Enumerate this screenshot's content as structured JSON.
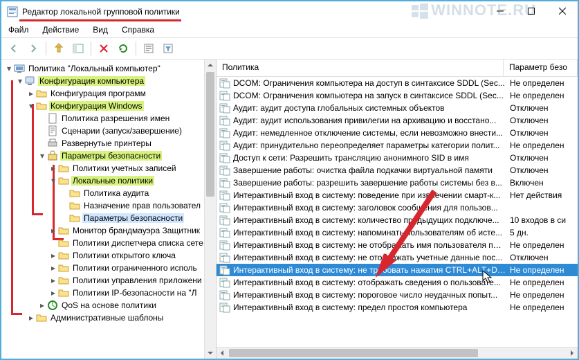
{
  "window": {
    "title": "Редактор локальной групповой политики"
  },
  "watermark": "WINNOTE.RU",
  "menu": {
    "file": "Файл",
    "action": "Действие",
    "view": "Вид",
    "help": "Справка"
  },
  "tree": {
    "root": "Политика \"Локальный компьютер\"",
    "comp_conf": "Конфигурация компьютера",
    "soft_conf": "Конфигурация программ",
    "win_conf": "Конфигурация Windows",
    "name_res": "Политика разрешения имен",
    "scripts": "Сценарии (запуск/завершение)",
    "printers": "Развернутые принтеры",
    "sec_params": "Параметры безопасности",
    "acct_pol": "Политики учетных записей",
    "local_pol": "Локальные политики",
    "audit": "Политика аудита",
    "user_rights": "Назначение прав пользовател",
    "sec_options": "Параметры безопасности",
    "wfas": "Монитор брандмауэра Защитник",
    "nlm": "Политики диспетчера списка сете",
    "pubkey": "Политики открытого ключа",
    "restrict": "Политики ограниченного исполь",
    "appctrl": "Политики управления приложени",
    "ipsec": "Политики IP-безопасности на \"Л",
    "qos": "QoS на основе политики",
    "adm": "Административные шаблоны"
  },
  "list": {
    "col_policy": "Политика",
    "col_setting": "Параметр безо",
    "rows": [
      {
        "name": "DCOM: Ограничения компьютера на доступ в синтаксисе SDDL (Sec...",
        "state": "Не определен"
      },
      {
        "name": "DCOM: Ограничения компьютера на запуск в синтаксисе SDDL (Sec...",
        "state": "Не определен"
      },
      {
        "name": "Аудит: аудит доступа глобальных системных объектов",
        "state": "Отключен"
      },
      {
        "name": "Аудит: аудит использования привилегии на архивацию и восстано...",
        "state": "Отключен"
      },
      {
        "name": "Аудит: немедленное отключение системы, если невозможно внести...",
        "state": "Отключен"
      },
      {
        "name": "Аудит: принудительно переопределяет параметры категории полит...",
        "state": "Не определен"
      },
      {
        "name": "Доступ к сети: Разрешить трансляцию анонимного SID в имя",
        "state": "Отключен"
      },
      {
        "name": "Завершение работы: очистка файла подкачки виртуальной памяти",
        "state": "Отключен"
      },
      {
        "name": "Завершение работы: разрешить завершение работы системы без в...",
        "state": "Включен"
      },
      {
        "name": "Интерактивный вход в систему:  поведение при извлечении смарт-к...",
        "state": "Нет действия"
      },
      {
        "name": "Интерактивный вход в систему: заголовок сообщения для пользов...",
        "state": ""
      },
      {
        "name": "Интерактивный вход в систему: количество предыдущих подключе...",
        "state": "10 входов в си"
      },
      {
        "name": "Интерактивный вход в систему: напоминать пользователям об исте...",
        "state": "5 дн."
      },
      {
        "name": "Интерактивный вход в систему: не отображать имя пользователя при ...",
        "state": "Не определен"
      },
      {
        "name": "Интерактивный вход в систему: не отображать учетные данные пос...",
        "state": "Отключен"
      },
      {
        "name": "Интерактивный вход в систему: не требовать нажатия CTRL+ALT+DEL",
        "state": "Не определен"
      },
      {
        "name": "Интерактивный вход в систему: отображать сведения о пользовате...",
        "state": "Не определен"
      },
      {
        "name": "Интерактивный вход в систему: пороговое число неудачных попыт...",
        "state": "Не определен"
      },
      {
        "name": "Интерактивный вход в систему: предел простоя компьютера",
        "state": "Не определен"
      }
    ],
    "selected_index": 15
  }
}
